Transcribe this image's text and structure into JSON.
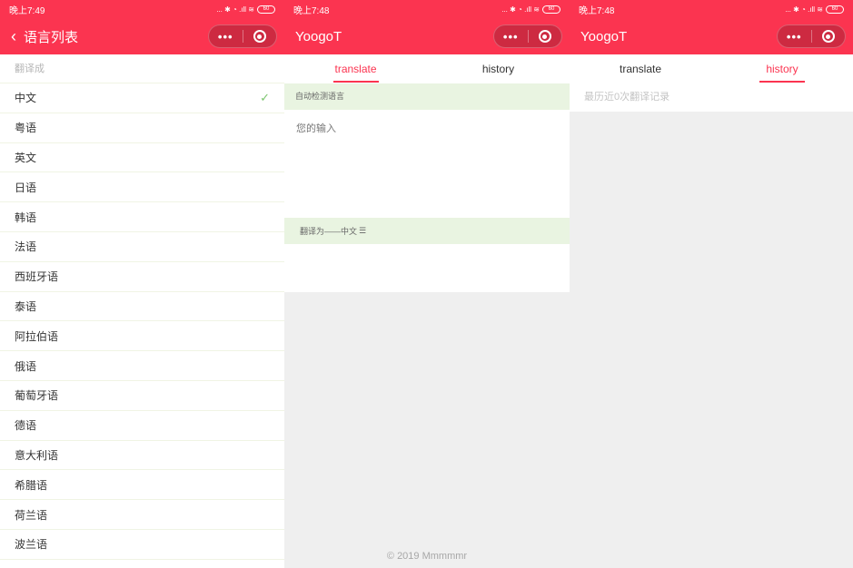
{
  "screen1": {
    "status": {
      "time": "晚上7:49",
      "icons": "... ✱ ◔ .ıll ≋",
      "battery": "60"
    },
    "title": "语言列表",
    "section_header": "翻译成",
    "languages": [
      {
        "label": "中文",
        "selected": true
      },
      {
        "label": "粤语"
      },
      {
        "label": "英文"
      },
      {
        "label": "日语"
      },
      {
        "label": "韩语"
      },
      {
        "label": "法语"
      },
      {
        "label": "西班牙语"
      },
      {
        "label": "泰语"
      },
      {
        "label": "阿拉伯语"
      },
      {
        "label": "俄语"
      },
      {
        "label": "葡萄牙语"
      },
      {
        "label": "德语"
      },
      {
        "label": "意大利语"
      },
      {
        "label": "希腊语"
      },
      {
        "label": "荷兰语"
      },
      {
        "label": "波兰语"
      }
    ],
    "check_glyph": "✓"
  },
  "screen2": {
    "status": {
      "time": "晚上7:48",
      "icons": "... ✱ ◔ .ıll ≋",
      "battery": "60"
    },
    "title": "YoogoT",
    "tabs": [
      {
        "label": "translate",
        "active": true
      },
      {
        "label": "history"
      }
    ],
    "detect_label": "自动检测语言",
    "input_placeholder": "您的输入",
    "translate_to_label": "翻译为——中文",
    "translate_to_icon": "☰",
    "footer": "© 2019 Mmmmmr"
  },
  "screen3": {
    "status": {
      "time": "晚上7:48",
      "icons": "... ✱ ◔ .ıll ≋",
      "battery": "60"
    },
    "title": "YoogoT",
    "tabs": [
      {
        "label": "translate"
      },
      {
        "label": "history",
        "active": true
      }
    ],
    "history_text": "最历近0次翻译记录"
  },
  "capsule": {
    "menu_glyph": "•••",
    "close_glyph": "◉"
  },
  "colors": {
    "brand": "#fb3450",
    "band": "#e9f4e1",
    "check": "#7cc56f",
    "page_bg": "#efefef"
  }
}
